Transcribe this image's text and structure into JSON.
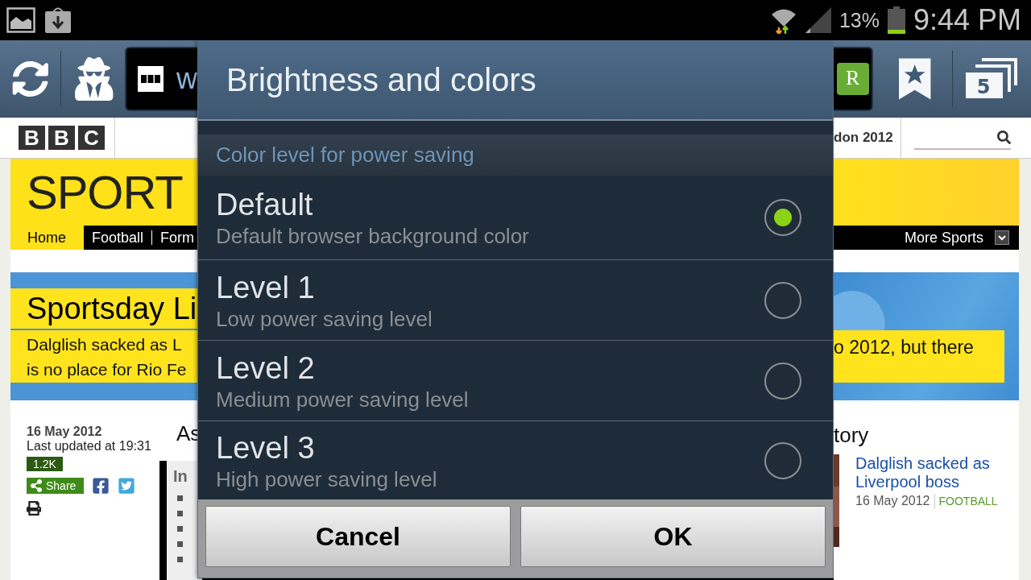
{
  "status_bar": {
    "battery": "13%",
    "time": "9:44 PM"
  },
  "browser_toolbar": {
    "url_visible": "w",
    "reader_label": "R",
    "tab_count": "5"
  },
  "page": {
    "logo": [
      "B",
      "B",
      "C"
    ],
    "header_link": "don 2012",
    "sport_title": "SPORT",
    "nav": [
      {
        "label": "Home",
        "selected": true
      },
      {
        "label": "Football",
        "selected": false
      },
      {
        "label": "Form",
        "selected": false
      }
    ],
    "more": "More Sports",
    "banner": {
      "title": "Sportsday Li",
      "lines": [
        "Dalglish sacked as L",
        "is no place for Rio Fe"
      ],
      "right_line": "o 2012, but there"
    },
    "article": {
      "date": "16 May 2012",
      "updated": "Last updated at 19:31",
      "count": "1.2K",
      "share": "Share",
      "heading": "As",
      "box_heading": "In"
    },
    "related": {
      "heading": "tory",
      "link": "Dalglish sacked as Liverpool boss",
      "date": "16 May 2012",
      "tag": "FOOTBALL"
    }
  },
  "dialog": {
    "title": "Brightness and colors",
    "section": "Color level for power saving",
    "options": [
      {
        "title": "Default",
        "subtitle": "Default browser background color",
        "selected": true
      },
      {
        "title": "Level 1",
        "subtitle": "Low power saving level",
        "selected": false
      },
      {
        "title": "Level 2",
        "subtitle": "Medium power saving level",
        "selected": false
      },
      {
        "title": "Level 3",
        "subtitle": "High power saving level",
        "selected": false
      }
    ],
    "buttons": [
      "Cancel",
      "OK"
    ]
  }
}
